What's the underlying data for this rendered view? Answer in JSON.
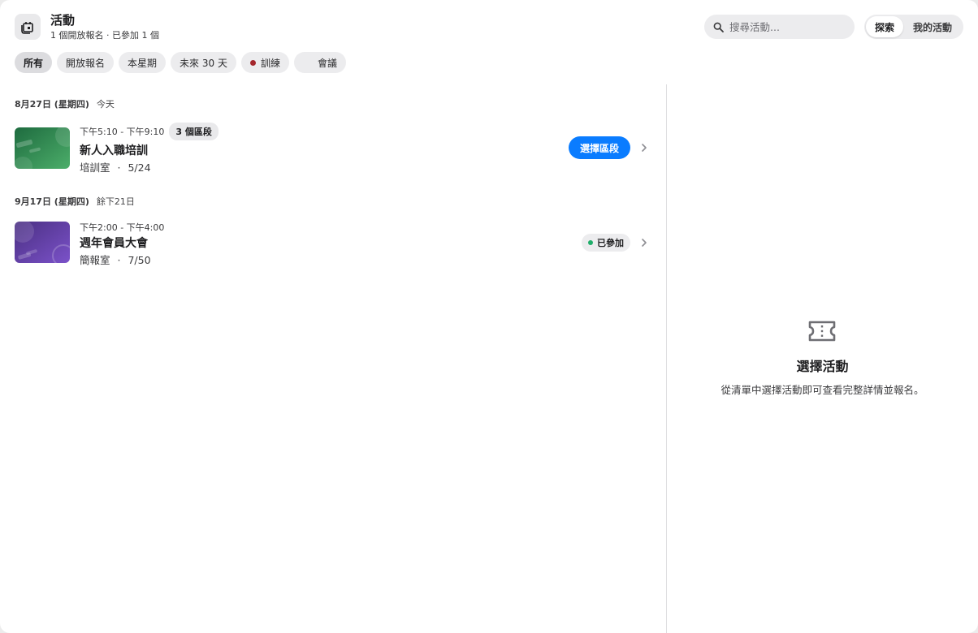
{
  "header": {
    "title": "活動",
    "subtitle": "1 個開放報名 · 已參加 1 個",
    "app_icon": "calendar-stack-icon",
    "search_placeholder": "搜尋活動...",
    "segments": [
      {
        "label": "探索",
        "active": true
      },
      {
        "label": "我的活動",
        "active": false
      }
    ]
  },
  "filters": [
    {
      "label": "所有",
      "active": true
    },
    {
      "label": "開放報名",
      "active": false
    },
    {
      "label": "本星期",
      "active": false
    },
    {
      "label": "未來 30 天",
      "active": false
    },
    {
      "label": "訓練",
      "active": false,
      "dot_color": "#a4262c"
    },
    {
      "label": "會議",
      "active": false,
      "dot_color": "transparent"
    }
  ],
  "days": [
    {
      "date": "8月27日 (星期四)",
      "relative": "今天",
      "events": [
        {
          "time": "下午5:10 - 下午9:10",
          "badge": "3 個區段",
          "title": "新人入職培訓",
          "location": "培訓室",
          "capacity": "5/24",
          "action_label": "選擇區段",
          "thumb_colors": [
            "#1e6b3f",
            "#4cae6a"
          ]
        }
      ]
    },
    {
      "date": "9月17日 (星期四)",
      "relative": "餘下21日",
      "events": [
        {
          "time": "下午2:00 - 下午4:00",
          "title": "週年會員大會",
          "location": "簡報室",
          "capacity": "7/50",
          "status_label": "已參加",
          "status_color": "#1fae6a",
          "thumb_colors": [
            "#4a2f82",
            "#7b52c9"
          ]
        }
      ]
    }
  ],
  "detail": {
    "icon": "ticket-icon",
    "title": "選擇活動",
    "text": "從清單中選擇活動即可查看完整詳情並報名。"
  },
  "meta_separator": "·"
}
